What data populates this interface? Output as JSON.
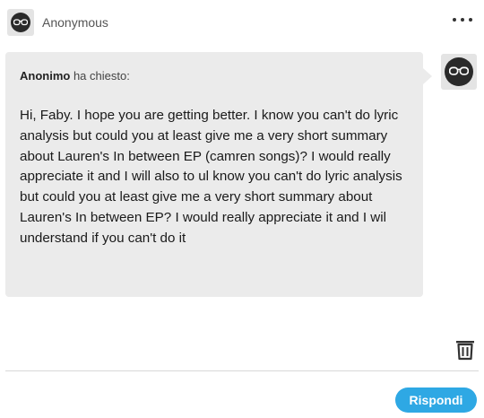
{
  "header": {
    "name": "Anonymous",
    "avatar_icon": "anonymous-glasses-avatar",
    "more_icon": "ellipsis-icon"
  },
  "question": {
    "asker_name": "Anonimo",
    "asked_label": " ha chiesto:",
    "text": "Hi, Faby. I hope you are getting better. I know you can't do lyric analysis but could you at least give me a very short summary about Lauren's In between EP (camren songs)? I would really appreciate it and I will also to ul know you can't do lyric analysis but could you at least give me a very short summary about Lauren's In between EP?  I would really appreciate it and I wil understand if you can't do it",
    "bubble_color": "#ebebeb"
  },
  "actions": {
    "delete_icon": "trash-icon",
    "reply_label": "Rispondi",
    "reply_color": "#2ea8e4"
  }
}
